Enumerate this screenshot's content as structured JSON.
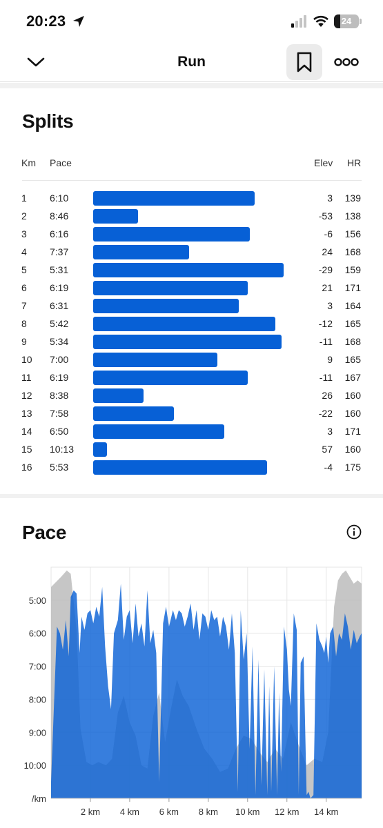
{
  "status_bar": {
    "time": "20:23",
    "battery": "24",
    "battery_level": 0.24,
    "icons": [
      "location-arrow-icon",
      "cellular-signal-icon",
      "wifi-icon",
      "battery-icon"
    ]
  },
  "nav": {
    "title": "Run",
    "icons": [
      "chevron-down-icon",
      "bookmark-icon",
      "more-options-icon"
    ]
  },
  "splits": {
    "title": "Splits",
    "headers": {
      "km": "Km",
      "pace": "Pace",
      "elev": "Elev",
      "hr": "HR"
    },
    "rows": [
      {
        "km": "1",
        "pace": "6:10",
        "elev": "3",
        "hr": "139"
      },
      {
        "km": "2",
        "pace": "8:46",
        "elev": "-53",
        "hr": "138"
      },
      {
        "km": "3",
        "pace": "6:16",
        "elev": "-6",
        "hr": "156"
      },
      {
        "km": "4",
        "pace": "7:37",
        "elev": "24",
        "hr": "168"
      },
      {
        "km": "5",
        "pace": "5:31",
        "elev": "-29",
        "hr": "159"
      },
      {
        "km": "6",
        "pace": "6:19",
        "elev": "21",
        "hr": "171"
      },
      {
        "km": "7",
        "pace": "6:31",
        "elev": "3",
        "hr": "164"
      },
      {
        "km": "8",
        "pace": "5:42",
        "elev": "-12",
        "hr": "165"
      },
      {
        "km": "9",
        "pace": "5:34",
        "elev": "-11",
        "hr": "168"
      },
      {
        "km": "10",
        "pace": "7:00",
        "elev": "9",
        "hr": "165"
      },
      {
        "km": "11",
        "pace": "6:19",
        "elev": "-11",
        "hr": "167"
      },
      {
        "km": "12",
        "pace": "8:38",
        "elev": "26",
        "hr": "160"
      },
      {
        "km": "13",
        "pace": "7:58",
        "elev": "-22",
        "hr": "160"
      },
      {
        "km": "14",
        "pace": "6:50",
        "elev": "3",
        "hr": "171"
      },
      {
        "km": "15",
        "pace": "10:13",
        "elev": "57",
        "hr": "160"
      },
      {
        "km": "16",
        "pace": "5:53",
        "elev": "-4",
        "hr": "175"
      }
    ]
  },
  "pace_section": {
    "title": "Pace",
    "info_icon": "info-icon"
  },
  "chart_data": {
    "type": "area",
    "y_axis": {
      "ticks": [
        "5:00",
        "6:00",
        "7:00",
        "8:00",
        "9:00",
        "10:00"
      ],
      "unit_label": "/km",
      "inverted": true,
      "ylim_min_per_km": [
        4.0,
        11.0
      ]
    },
    "x_axis": {
      "ticks": [
        "2 km",
        "4 km",
        "6 km",
        "8 km",
        "10 km",
        "12 km",
        "14 km"
      ],
      "xlim_km": [
        0,
        15.8
      ]
    },
    "grid": true,
    "colors": {
      "pace": "#0b62d6",
      "elevation": "#bcbcbc"
    },
    "series": [
      {
        "key": "pace",
        "x": [
          0,
          0.3,
          0.45,
          0.6,
          0.75,
          0.9,
          1.0,
          1.15,
          1.3,
          1.45,
          1.55,
          1.7,
          1.85,
          2.0,
          2.15,
          2.3,
          2.45,
          2.6,
          2.75,
          2.9,
          3.05,
          3.2,
          3.4,
          3.55,
          3.7,
          3.85,
          4.0,
          4.15,
          4.3,
          4.45,
          4.6,
          4.75,
          4.9,
          5.05,
          5.2,
          5.35,
          5.5,
          5.7,
          5.85,
          6.0,
          6.2,
          6.35,
          6.5,
          6.65,
          6.8,
          6.95,
          7.1,
          7.25,
          7.4,
          7.55,
          7.7,
          7.85,
          8.0,
          8.15,
          8.3,
          8.45,
          8.6,
          8.75,
          8.9,
          9.05,
          9.2,
          9.35,
          9.5,
          9.65,
          9.8,
          9.95,
          10.1,
          10.25,
          10.4,
          10.55,
          10.7,
          10.85,
          11.0,
          11.1,
          11.2,
          11.35,
          11.5,
          11.6,
          11.7,
          11.85,
          12.0,
          12.1,
          12.2,
          12.35,
          12.5,
          12.6,
          12.7,
          12.85,
          13.0,
          13.1,
          13.2,
          13.35,
          13.5,
          13.65,
          13.8,
          13.9,
          14.0,
          14.1,
          14.2,
          14.35,
          14.5,
          14.65,
          14.8,
          14.95,
          15.1,
          15.25,
          15.4,
          15.55,
          15.7,
          15.8
        ],
        "y": [
          10.5,
          5.8,
          6.0,
          6.5,
          5.6,
          6.7,
          4.9,
          4.7,
          4.8,
          6.6,
          5.5,
          5.9,
          5.4,
          5.3,
          5.7,
          5.2,
          5.5,
          4.6,
          6.4,
          7.6,
          8.3,
          6.0,
          5.6,
          4.5,
          6.2,
          5.5,
          5.3,
          6.3,
          5.1,
          6.1,
          5.7,
          6.4,
          4.7,
          6.3,
          5.9,
          6.6,
          10.5,
          5.7,
          5.2,
          5.8,
          5.3,
          5.6,
          5.3,
          5.4,
          5.8,
          5.5,
          5.1,
          5.9,
          5.3,
          6.2,
          5.4,
          5.5,
          5.9,
          5.3,
          5.6,
          5.5,
          6.1,
          5.5,
          5.8,
          6.5,
          5.4,
          6.6,
          10.8,
          5.3,
          6.8,
          6.0,
          9.5,
          6.4,
          10.9,
          6.8,
          10.6,
          7.1,
          10.9,
          7.6,
          10.8,
          7.0,
          10.9,
          7.8,
          10.2,
          5.8,
          6.5,
          7.7,
          8.2,
          5.4,
          5.9,
          10.9,
          6.9,
          6.7,
          10.9,
          10.8,
          11.0,
          10.9,
          5.7,
          6.2,
          6.4,
          6.6,
          6.1,
          6.9,
          6.0,
          5.8,
          6.7,
          6.0,
          6.2,
          5.4,
          5.8,
          6.5,
          5.9,
          6.3,
          6.1,
          6.0
        ]
      },
      {
        "key": "elevation",
        "x": [
          0,
          0.5,
          0.8,
          1.0,
          1.3,
          1.5,
          1.8,
          2.1,
          2.4,
          2.8,
          3.1,
          3.4,
          3.7,
          4.0,
          4.3,
          4.6,
          4.9,
          5.2,
          5.5,
          5.8,
          6.1,
          6.4,
          6.7,
          7.0,
          7.4,
          7.8,
          8.2,
          8.6,
          9.0,
          9.4,
          9.8,
          10.2,
          10.6,
          11.0,
          11.4,
          11.8,
          12.2,
          12.6,
          13.0,
          13.4,
          13.8,
          14.1,
          14.4,
          14.6,
          14.8,
          15.0,
          15.2,
          15.4,
          15.6,
          15.8
        ],
        "y": [
          4.6,
          4.3,
          4.1,
          4.2,
          5.9,
          8.9,
          9.9,
          10.0,
          9.9,
          10.0,
          9.8,
          8.4,
          7.9,
          8.7,
          9.1,
          10.0,
          10.1,
          8.5,
          7.8,
          9.3,
          8.3,
          7.4,
          7.9,
          8.2,
          8.9,
          9.5,
          9.8,
          10.2,
          10.1,
          9.5,
          9.1,
          9.2,
          9.6,
          9.9,
          9.5,
          9.8,
          8.7,
          9.4,
          10.0,
          9.8,
          9.9,
          9.0,
          5.2,
          4.4,
          4.2,
          4.1,
          4.3,
          4.5,
          4.4,
          4.5
        ]
      }
    ]
  }
}
